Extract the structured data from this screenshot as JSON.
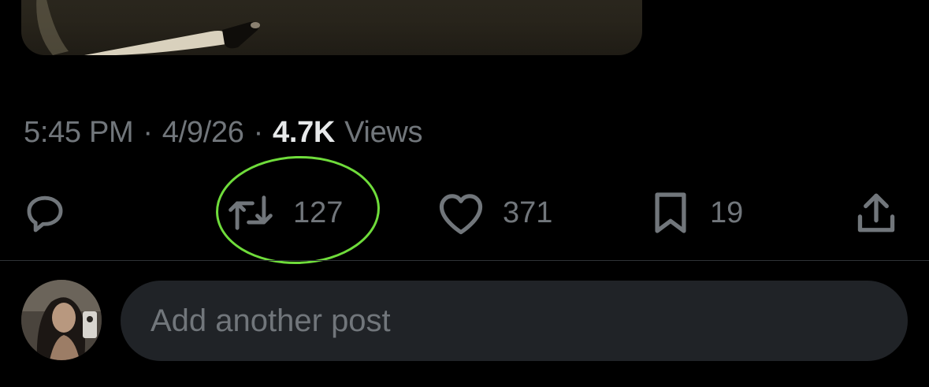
{
  "post": {
    "time": "5:45 PM",
    "date": "4/9/26",
    "separator": "·",
    "views_count": "4.7K",
    "views_label": "Views"
  },
  "actions": {
    "reply_icon": "speech-bubble-icon",
    "repost_icon": "repost-arrows-icon",
    "repost_count": "127",
    "like_icon": "heart-icon",
    "like_count": "371",
    "bookmark_icon": "bookmark-icon",
    "bookmark_count": "19",
    "share_icon": "share-upload-icon"
  },
  "annotation": {
    "highlight_color": "#6fdc3b"
  },
  "compose": {
    "placeholder": "Add another post"
  },
  "colors": {
    "background": "#000000",
    "muted_text": "#71767b",
    "primary_text": "#e7e9ea",
    "input_bg": "#202327"
  }
}
